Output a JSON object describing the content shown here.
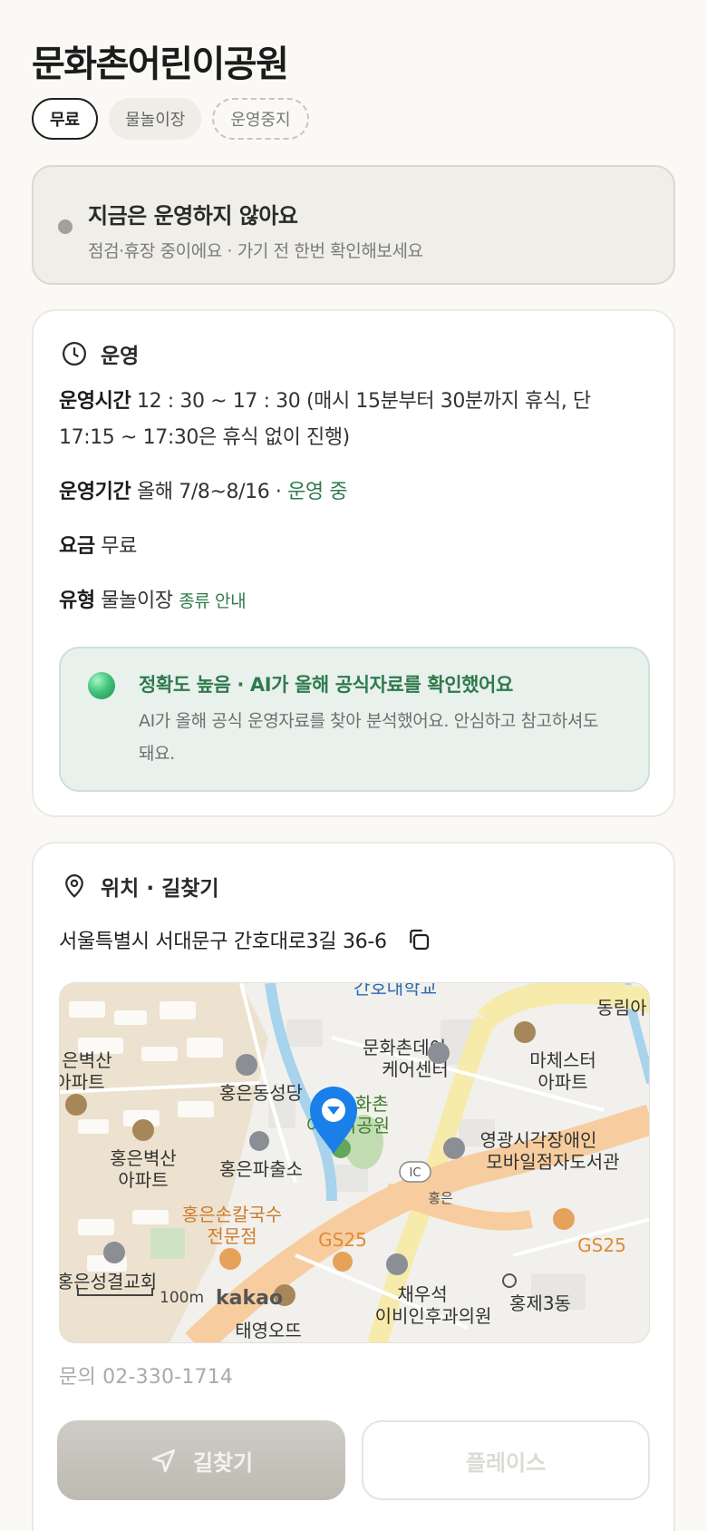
{
  "place": {
    "title": "문화촌어린이공원"
  },
  "chips": [
    {
      "label": "무료"
    },
    {
      "label": "물놀이장"
    },
    {
      "label": "운영중지"
    }
  ],
  "status": {
    "title": "지금은 운영하지 않아요",
    "subtitle": "점검·휴장 중이에요 · 가기 전 한번 확인해보세요"
  },
  "operation": {
    "header": "운영",
    "hours_label": "운영시간",
    "hours_value_line1": "12 : 30 ~ 17 : 30 (매시 15분부터 30분까지 휴식, 단",
    "hours_value_line2": "17:15 ~ 17:30은 휴식 없이 진행)",
    "period_label": "운영기간",
    "period_value": "올해 7/8~8/16 ·",
    "period_status": "운영 중",
    "fee_label": "요금",
    "fee_value": "무료",
    "type_label": "유형",
    "type_value": "물놀이장",
    "type_link": "종류 안내"
  },
  "ai_notice": {
    "title": "정확도 높음 · AI가 올해 공식자료를 확인했어요",
    "desc": "AI가 올해 공식 운영자료를 찾아 분석했어요. 안심하고 참고하셔도 돼요."
  },
  "location": {
    "header": "위치 · 길찾기",
    "address": "서울특별시 서대문구 간호대로3길 36-6",
    "contact": "문의 02-330-1714"
  },
  "map_labels": {
    "univ": "간호대학교",
    "dongrim": "동림아",
    "daycare1": "문화촌데이",
    "daycare2": "케어센터",
    "mache1": "마체스터",
    "mache2": "아파트",
    "byeok1": "은벽산",
    "byeok2": "아파트",
    "cathedral": "홍은동성당",
    "park1": "문화촌",
    "park2": "어린이공원",
    "library1": "영광시각장애인",
    "library2": "모바일점자도서관",
    "hb1": "홍은벽산",
    "hb2": "아파트",
    "police": "홍은파출소",
    "ic": "IC",
    "hongeun": "홍은",
    "noodle1": "홍은손칼국수",
    "noodle2": "전문점",
    "gs25a": "GS25",
    "gs25b": "GS25",
    "church": "홍은성결교회",
    "scale": "100m",
    "kakao": "kakao",
    "clinic1": "채우석",
    "clinic2": "이비인후과의원",
    "hj3": "홍제3동",
    "bottom": "태영오뜨"
  },
  "buttons": {
    "directions": "길찾기",
    "place": "플레이스"
  },
  "colors": {
    "accent_green": "#2f7a4e",
    "status_dot": "#a4a095",
    "map_pin": "#1a7fe8"
  }
}
